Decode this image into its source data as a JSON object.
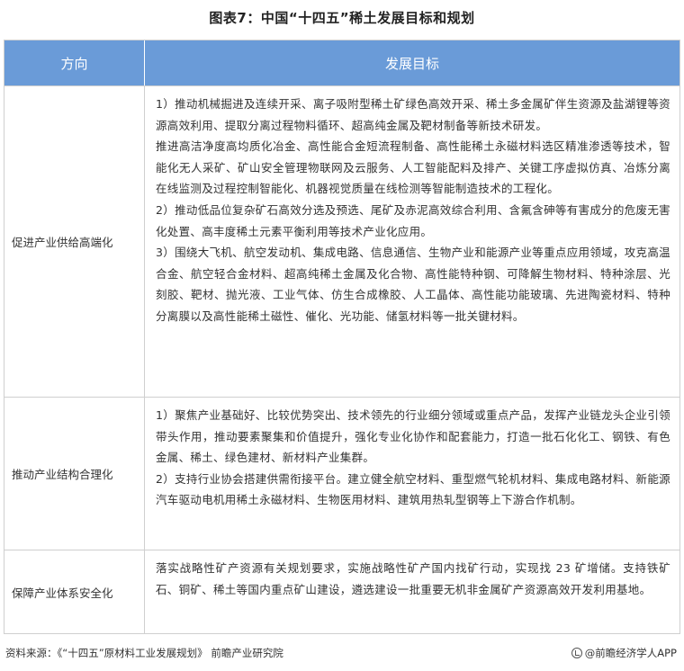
{
  "title": "图表7：中国“十四五”稀土发展目标和规划",
  "table": {
    "headers": [
      "方向",
      "发展目标"
    ],
    "rows": [
      {
        "direction": "促进产业供给高端化",
        "paragraphs": [
          "1）推动机械掘进及连续开采、离子吸附型稀土矿绿色高效开采、稀土多金属矿伴生资源及盐湖锂等资源高效利用、提取分离过程物料循环、超高纯金属及靶材制备等新技术研发。",
          "推进高洁净度高均质化冶金、高性能合金短流程制备、高性能稀土永磁材料选区精准渗透等技术，智能化无人采矿、矿山安全管理物联网及云服务、人工智能配料及排产、关键工序虚拟仿真、冶炼分离在线监测及过程控制智能化、机器视觉质量在线检测等智能制造技术的工程化。",
          "2）推动低品位复杂矿石高效分选及预选、尾矿及赤泥高效综合利用、含氟含砷等有害成分的危废无害化处置、高丰度稀土元素平衡利用等技术产业化应用。",
          "3）围绕大飞机、航空发动机、集成电路、信息通信、生物产业和能源产业等重点应用领域，攻克高温合金、航空轻合金材料、超高纯稀土金属及化合物、高性能特种钢、可降解生物材料、特种涂层、光刻胶、靶材、抛光液、工业气体、仿生合成橡胶、人工晶体、高性能功能玻璃、先进陶瓷材料、特种分离膜以及高性能稀土磁性、催化、光功能、储氢材料等一批关键材料。"
        ]
      },
      {
        "direction": "推动产业结构合理化",
        "paragraphs": [
          "1）聚焦产业基础好、比较优势突出、技术领先的行业细分领域或重点产品，发挥产业链龙头企业引领带头作用，推动要素聚集和价值提升，强化专业化协作和配套能力，打造一批石化化工、钢铁、有色金属、稀土、绿色建材、新材料产业集群。",
          "2）支持行业协会搭建供需衔接平台。建立健全航空材料、重型燃气轮机材料、集成电路材料、新能源汽车驱动电机用稀土永磁材料、生物医用材料、建筑用热轧型钢等上下游合作机制。"
        ]
      },
      {
        "direction": "保障产业体系安全化",
        "paragraphs": [
          "落实战略性矿产资源有关规划要求，实施战略性矿产国内找矿行动，实现找 23 矿增储。支持铁矿石、铜矿、稀土等国内重点矿山建设，遴选建设一批重要无机非金属矿产资源高效开发利用基地。"
        ]
      }
    ]
  },
  "footer": {
    "source": "资料来源：《“十四五”原材料工业发展规划》 前瞻产业研究院",
    "brand": "@前瞻经济学人APP",
    "brand_icon": "qianzhan-logo-icon"
  }
}
